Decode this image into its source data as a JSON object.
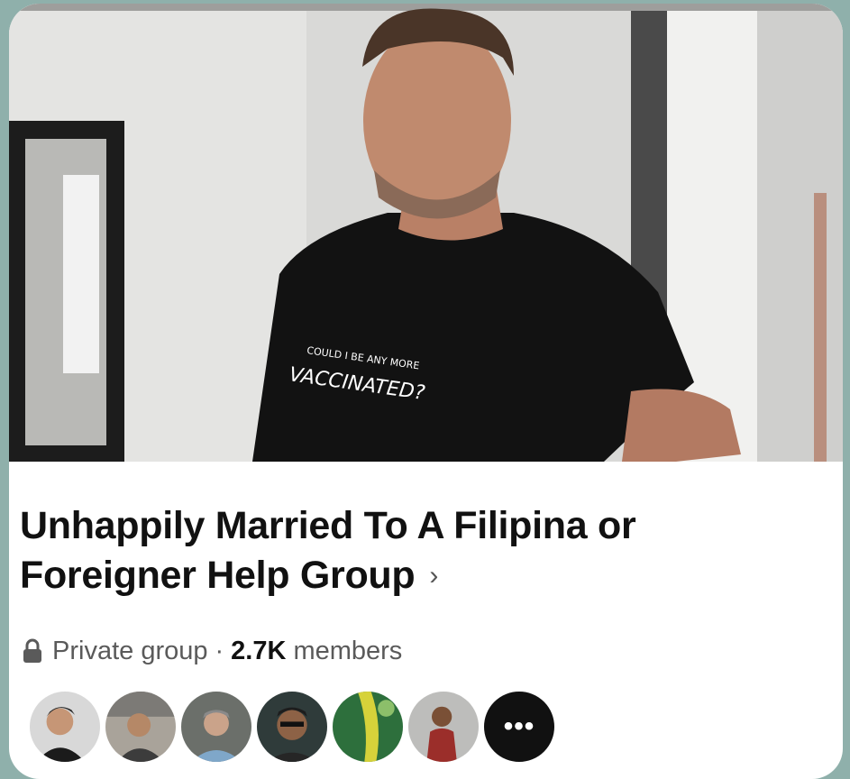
{
  "group": {
    "title": "Unhappily Married To A Filipina or Foreigner Help Group",
    "chevron": "›",
    "privacy_icon": "lock-icon",
    "privacy": "Private group",
    "separator": "·",
    "member_count": "2.7K",
    "members_label": "members"
  },
  "cover": {
    "shirt_text_small": "COULD I BE ANY MORE",
    "shirt_text_large": "VACCINATED?"
  },
  "member_avatars": {
    "count_shown": 6,
    "more_icon": "more-dots-icon",
    "more_label": "•••"
  },
  "colors": {
    "background": "#8fb0ab",
    "card": "#ffffff",
    "title": "#111111",
    "meta": "#5a5a5a"
  }
}
